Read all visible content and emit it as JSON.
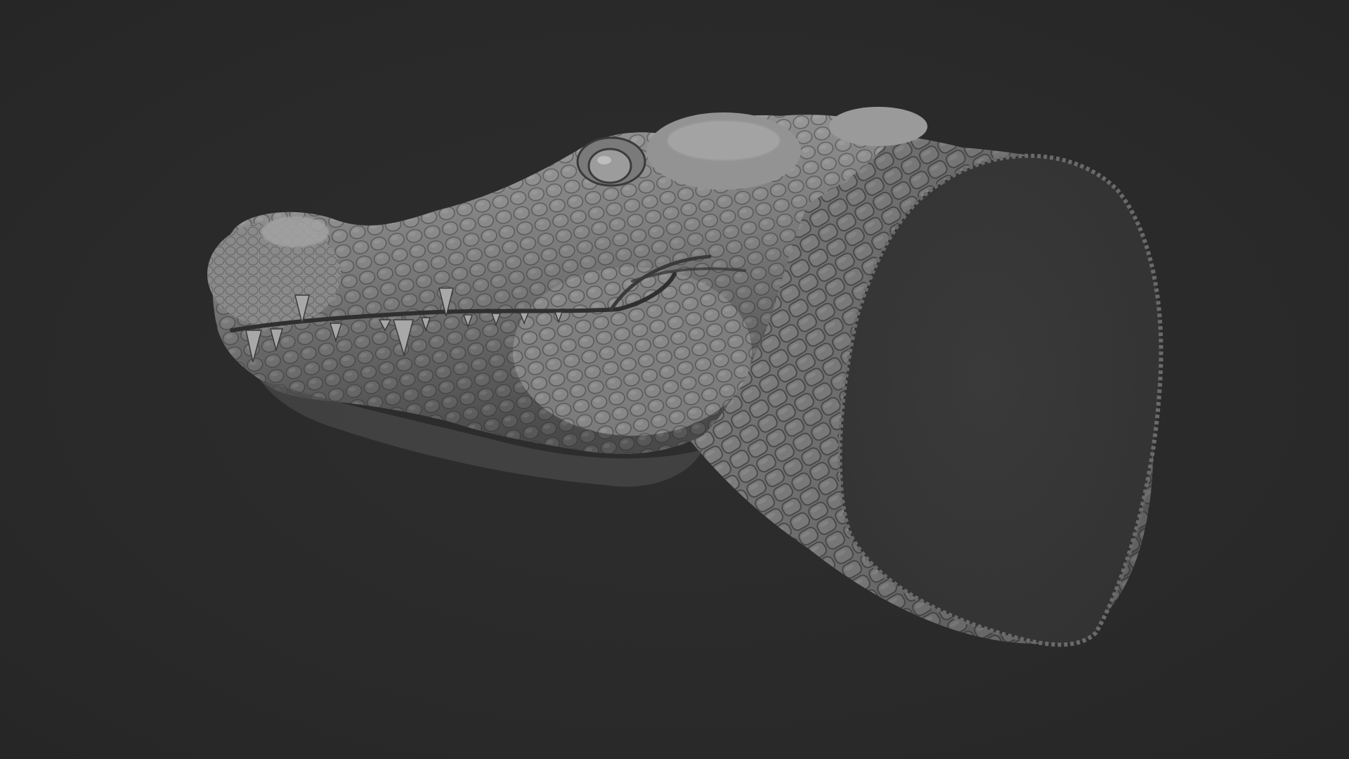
{
  "scene": {
    "subject_icon": "crocodile-head-sculpt-icon",
    "background_color": "#2b2b2b",
    "clay_color": "#8a8a8a",
    "cut_face_color": "#363636"
  }
}
